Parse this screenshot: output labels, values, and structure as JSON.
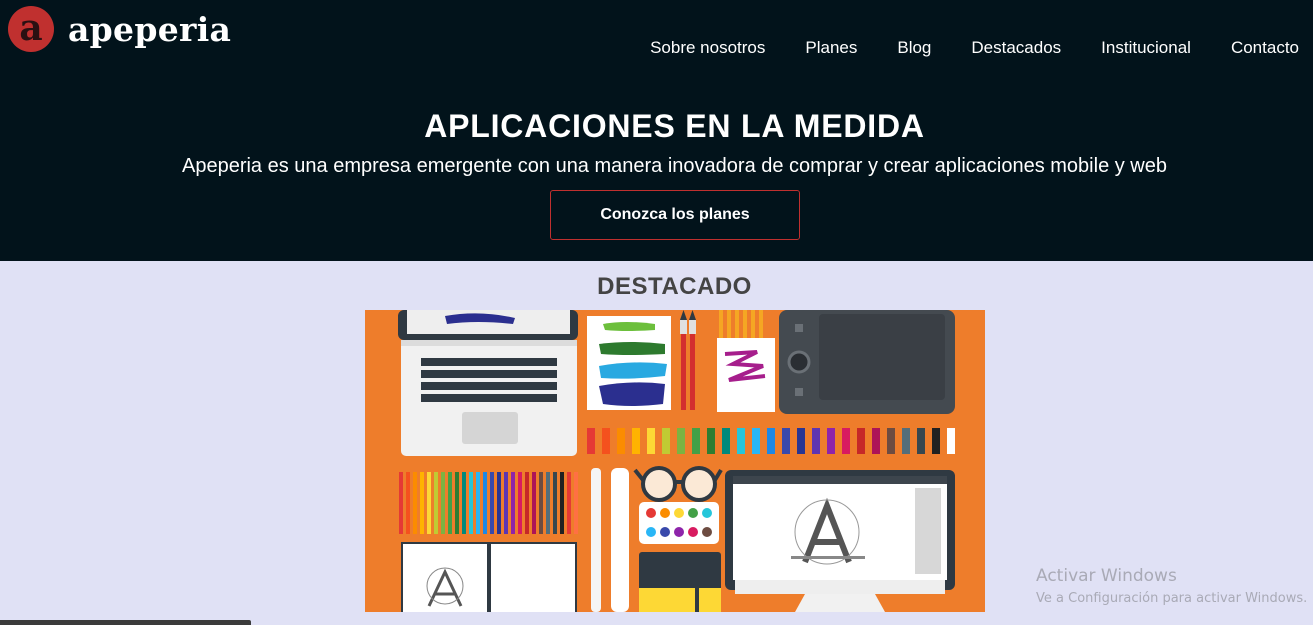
{
  "brand": {
    "logo_letter": "a",
    "name": "apeperia",
    "accent": "#c0302f",
    "header_bg": "#02131b"
  },
  "nav": {
    "items": [
      {
        "label": "Sobre nosotros"
      },
      {
        "label": "Planes"
      },
      {
        "label": "Blog"
      },
      {
        "label": "Destacados"
      },
      {
        "label": "Institucional"
      },
      {
        "label": "Contacto"
      }
    ]
  },
  "hero": {
    "title": "APLICACIONES EN LA MEDIDA",
    "subtitle": "Apeperia es una empresa emergente con una manera inovadora de comprar y crear aplicaciones mobile y web",
    "cta_label": "Conozca los planes"
  },
  "featured": {
    "title": "DESTACADO",
    "image": {
      "subject": "flat illustration of design desk: laptop, paint strokes, brushes, sketchbook, graphics tablet, paint tubes, pencils, glasses, watercolor palette, notebook, monitor showing letter A",
      "background": "#ee7d2b"
    }
  },
  "os_watermark": {
    "title": "Activar Windows",
    "subtitle": "Ve a Configuración para activar Windows."
  }
}
